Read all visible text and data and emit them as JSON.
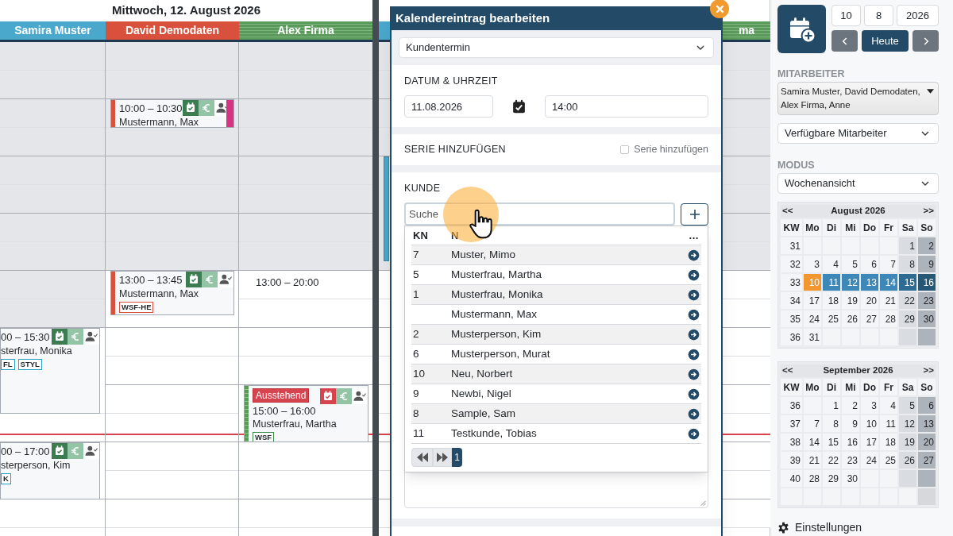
{
  "day_left": {
    "title": "Mittwoch, 12. August 2026",
    "staff": [
      {
        "name": "Samira Muster",
        "color": "#4aa8cc",
        "striped": false,
        "slots": [
          {
            "open": false
          },
          {
            "open": false
          },
          {
            "open": false
          },
          {
            "open": false
          },
          {
            "open": false
          },
          {
            "open": false
          },
          {
            "open": false
          },
          {
            "open": false
          },
          {
            "open": false
          },
          {
            "open": false
          },
          {
            "open": true,
            "event": {
              "kind": "hour_half",
              "time": "00 – 15:30",
              "customer": "sterfrau, Monika",
              "pending": false,
              "tags": [
                {
                  "label": "FL",
                  "color": "#2a9dc4"
                },
                {
                  "label": "STYL",
                  "color": "#2a9dc4"
                }
              ]
            }
          },
          {
            "open": true,
            "now": true
          },
          {
            "open": true,
            "event": {
              "kind": "hour",
              "time": "00 – 17:00",
              "customer": "sterperson, Kim",
              "pending": false,
              "tags": [
                {
                  "label": "K",
                  "color": "#2a9dc4"
                }
              ]
            }
          },
          {
            "open": true
          }
        ]
      },
      {
        "name": "David Demodaten",
        "color": "#d9513c",
        "striped": false,
        "slots": [
          {
            "open": false
          },
          {
            "open": false
          },
          {
            "open": false,
            "event": {
              "kind": "half",
              "time": "10:00 – 10:30",
              "customer": "Mustermann, Max",
              "color": "#d9513c",
              "end_mark": {
                "color": "#d63384"
              },
              "pending": false
            }
          },
          {
            "open": false
          },
          {
            "open": false
          },
          {
            "open": false
          },
          {
            "open": false
          },
          {
            "open": false
          },
          {
            "open": true,
            "event": {
              "kind": "three_quarters",
              "time": "13:00 – 13:45",
              "customer": "Mustermann, Max",
              "color": "#d9513c",
              "pending": false,
              "tags": [
                {
                  "label": "WSF-HE",
                  "color": "#d9513c"
                }
              ]
            }
          },
          {
            "open": true
          },
          {
            "open": true
          },
          {
            "open": true
          },
          {
            "open": true,
            "now": true
          },
          {
            "open": true
          },
          {
            "open": true
          },
          {
            "open": true
          }
        ]
      },
      {
        "name": "Alex Firma",
        "color": "#5a9a5a",
        "striped": true,
        "slots": [
          {
            "open": false
          },
          {
            "open": false
          },
          {
            "open": false
          },
          {
            "open": false
          },
          {
            "open": false
          },
          {
            "open": false
          },
          {
            "open": false
          },
          {
            "open": false
          },
          {
            "open": true,
            "note": "13:00 – 20:00"
          },
          {
            "open": true
          },
          {
            "open": true
          },
          {
            "open": true
          },
          {
            "open": true,
            "now": true,
            "event": {
              "kind": "hour",
              "badge": "Ausstehend",
              "time": "15:00 – 16:00",
              "customer": "Musterfrau, Martha",
              "color": "#5a9a5a",
              "striped": true,
              "pending": true,
              "tags": [
                {
                  "label": "WSF",
                  "color": "#3a8a4a"
                }
              ]
            }
          },
          {
            "open": true
          },
          {
            "open": true
          },
          {
            "open": true
          }
        ]
      }
    ]
  },
  "day_right": {
    "staff": [
      {
        "color": "#4aa8cc",
        "striped": false,
        "slots": [
          {
            "open": false
          },
          {
            "open": false
          },
          {
            "open": false
          },
          {
            "open": false
          },
          {
            "open": false,
            "event": {
              "kind": "edge",
              "color": "#4aa8cc"
            }
          },
          {
            "open": true
          },
          {
            "open": true
          },
          {
            "open": true
          },
          {
            "open": true
          },
          {
            "open": true
          },
          {
            "open": true,
            "now": true
          },
          {
            "open": true
          },
          {
            "open": true
          },
          {
            "open": true
          }
        ]
      },
      {
        "name": "ma",
        "color": "#5a9a5a",
        "striped": true,
        "slots": [
          {
            "open": false
          },
          {
            "open": false
          },
          {
            "open": false
          },
          {
            "open": false
          },
          {
            "open": false
          },
          {
            "open": false
          },
          {
            "open": false
          },
          {
            "open": false
          },
          {
            "open": true
          },
          {
            "open": true
          },
          {
            "open": true
          },
          {
            "open": true
          },
          {
            "open": true
          },
          {
            "open": true,
            "now": true
          },
          {
            "open": true
          },
          {
            "open": true
          },
          {
            "open": true
          }
        ]
      }
    ]
  },
  "dialog": {
    "title": "Kalendereintrag bearbeiten",
    "type": "Kundentermin",
    "date_section": {
      "heading": "DATUM & UHRZEIT",
      "date": "11.08.2026",
      "time": "14:00"
    },
    "series": {
      "heading": "SERIE HINZUFÜGEN",
      "checkbox_label": "Serie hinzufügen",
      "checked": false
    },
    "customer": {
      "heading": "KUNDE",
      "placeholder": "Suche",
      "columns": [
        "KN",
        "N",
        "…"
      ],
      "rows": [
        {
          "kn": "7",
          "name": "Muster, Mimo"
        },
        {
          "kn": "5",
          "name": "Musterfrau, Martha"
        },
        {
          "kn": "1",
          "name": "Musterfrau, Monika"
        },
        {
          "name": "Mustermann, Max"
        },
        {
          "kn": "2",
          "name": "Musterperson, Kim"
        },
        {
          "kn": "6",
          "name": "Musterperson, Murat"
        },
        {
          "kn": "10",
          "name": "Neu, Norbert"
        },
        {
          "kn": "9",
          "name": "Newbi, Nigel"
        },
        {
          "kn": "8",
          "name": "Sample, Sam"
        },
        {
          "kn": "11",
          "name": "Testkunde, Tobias"
        }
      ],
      "pages": [
        {
          "label": "1",
          "selected": true
        }
      ]
    }
  },
  "sidebar": {
    "date_fields": [
      "10",
      "8",
      "2026"
    ],
    "today_button": "Heute",
    "staff_label": "MITARBEITER",
    "staff_selection": "Samira Muster, David Demodaten, Alex Firma, Anne",
    "staff_filter": "Verfügbare Mitarbeiter",
    "mode_label": "MODUS",
    "mode": "Wochenansicht",
    "months": [
      {
        "title": "August 2026",
        "prev": "<<",
        "next": ">>",
        "weekdays": [
          "KW",
          "Mo",
          "Di",
          "Mi",
          "Do",
          "Fr",
          "Sa",
          "So"
        ],
        "weeks": [
          {
            "kw": "31",
            "days": [
              {
                "kind": "day"
              },
              {
                "kind": "day"
              },
              {
                "kind": "day"
              },
              {
                "kind": "day"
              },
              {
                "kind": "day"
              },
              {
                "label": "1",
                "kind": "sat"
              },
              {
                "label": "2",
                "kind": "sun"
              }
            ]
          },
          {
            "kw": "32",
            "days": [
              {
                "label": "3",
                "kind": "day"
              },
              {
                "label": "4",
                "kind": "day"
              },
              {
                "label": "5",
                "kind": "day"
              },
              {
                "label": "6",
                "kind": "day"
              },
              {
                "label": "7",
                "kind": "day"
              },
              {
                "label": "8",
                "kind": "sat"
              },
              {
                "label": "9",
                "kind": "sun"
              }
            ]
          },
          {
            "kw": "33",
            "days": [
              {
                "label": "10",
                "kind": "today"
              },
              {
                "label": "11",
                "kind": "selected"
              },
              {
                "label": "12",
                "kind": "selected"
              },
              {
                "label": "13",
                "kind": "selected"
              },
              {
                "label": "14",
                "kind": "selected"
              },
              {
                "label": "15",
                "kind": "selected_sat"
              },
              {
                "label": "16",
                "kind": "selected_sun"
              }
            ]
          },
          {
            "kw": "34",
            "days": [
              {
                "label": "17",
                "kind": "day"
              },
              {
                "label": "18",
                "kind": "day"
              },
              {
                "label": "19",
                "kind": "day"
              },
              {
                "label": "20",
                "kind": "day"
              },
              {
                "label": "21",
                "kind": "day"
              },
              {
                "label": "22",
                "kind": "sat"
              },
              {
                "label": "23",
                "kind": "sun"
              }
            ]
          },
          {
            "kw": "35",
            "days": [
              {
                "label": "24",
                "kind": "day"
              },
              {
                "label": "25",
                "kind": "day"
              },
              {
                "label": "26",
                "kind": "day"
              },
              {
                "label": "27",
                "kind": "day"
              },
              {
                "label": "28",
                "kind": "day"
              },
              {
                "label": "29",
                "kind": "sat"
              },
              {
                "label": "30",
                "kind": "sun"
              }
            ]
          },
          {
            "kw": "36",
            "days": [
              {
                "label": "31",
                "kind": "day"
              },
              {
                "kind": "day"
              },
              {
                "kind": "day"
              },
              {
                "kind": "day"
              },
              {
                "kind": "day"
              },
              {
                "kind": "sat"
              },
              {
                "kind": "sun"
              }
            ]
          }
        ]
      },
      {
        "title": "September 2026",
        "prev": "<<",
        "next": ">>",
        "weekdays": [
          "KW",
          "Mo",
          "Di",
          "Mi",
          "Do",
          "Fr",
          "Sa",
          "So"
        ],
        "weeks": [
          {
            "kw": "36",
            "days": [
              {
                "kind": "day"
              },
              {
                "label": "1",
                "kind": "day"
              },
              {
                "label": "2",
                "kind": "day"
              },
              {
                "label": "3",
                "kind": "day"
              },
              {
                "label": "4",
                "kind": "day"
              },
              {
                "label": "5",
                "kind": "sat"
              },
              {
                "label": "6",
                "kind": "sun"
              }
            ]
          },
          {
            "kw": "37",
            "days": [
              {
                "label": "7",
                "kind": "day"
              },
              {
                "label": "8",
                "kind": "day"
              },
              {
                "label": "9",
                "kind": "day"
              },
              {
                "label": "10",
                "kind": "day"
              },
              {
                "label": "11",
                "kind": "day"
              },
              {
                "label": "12",
                "kind": "sat"
              },
              {
                "label": "13",
                "kind": "sun"
              }
            ]
          },
          {
            "kw": "38",
            "days": [
              {
                "label": "14",
                "kind": "day"
              },
              {
                "label": "15",
                "kind": "day"
              },
              {
                "label": "16",
                "kind": "day"
              },
              {
                "label": "17",
                "kind": "day"
              },
              {
                "label": "18",
                "kind": "day"
              },
              {
                "label": "19",
                "kind": "sat"
              },
              {
                "label": "20",
                "kind": "sun"
              }
            ]
          },
          {
            "kw": "39",
            "days": [
              {
                "label": "21",
                "kind": "day"
              },
              {
                "label": "22",
                "kind": "day"
              },
              {
                "label": "23",
                "kind": "day"
              },
              {
                "label": "24",
                "kind": "day"
              },
              {
                "label": "25",
                "kind": "day"
              },
              {
                "label": "26",
                "kind": "sat"
              },
              {
                "label": "27",
                "kind": "sun"
              }
            ]
          },
          {
            "kw": "40",
            "days": [
              {
                "label": "28",
                "kind": "day"
              },
              {
                "label": "29",
                "kind": "day"
              },
              {
                "label": "30",
                "kind": "day"
              },
              {
                "kind": "day"
              },
              {
                "kind": "day"
              },
              {
                "kind": "sat"
              },
              {
                "kind": "sun"
              }
            ]
          },
          {
            "days": [
              {
                "kind": "blank"
              },
              {
                "kind": "blank"
              },
              {
                "kind": "blank"
              },
              {
                "kind": "blank"
              },
              {
                "kind": "blank"
              },
              {
                "kind": "blank"
              },
              {
                "kind": "blank_sun"
              }
            ]
          }
        ]
      }
    ],
    "settings": "Einstellungen"
  }
}
